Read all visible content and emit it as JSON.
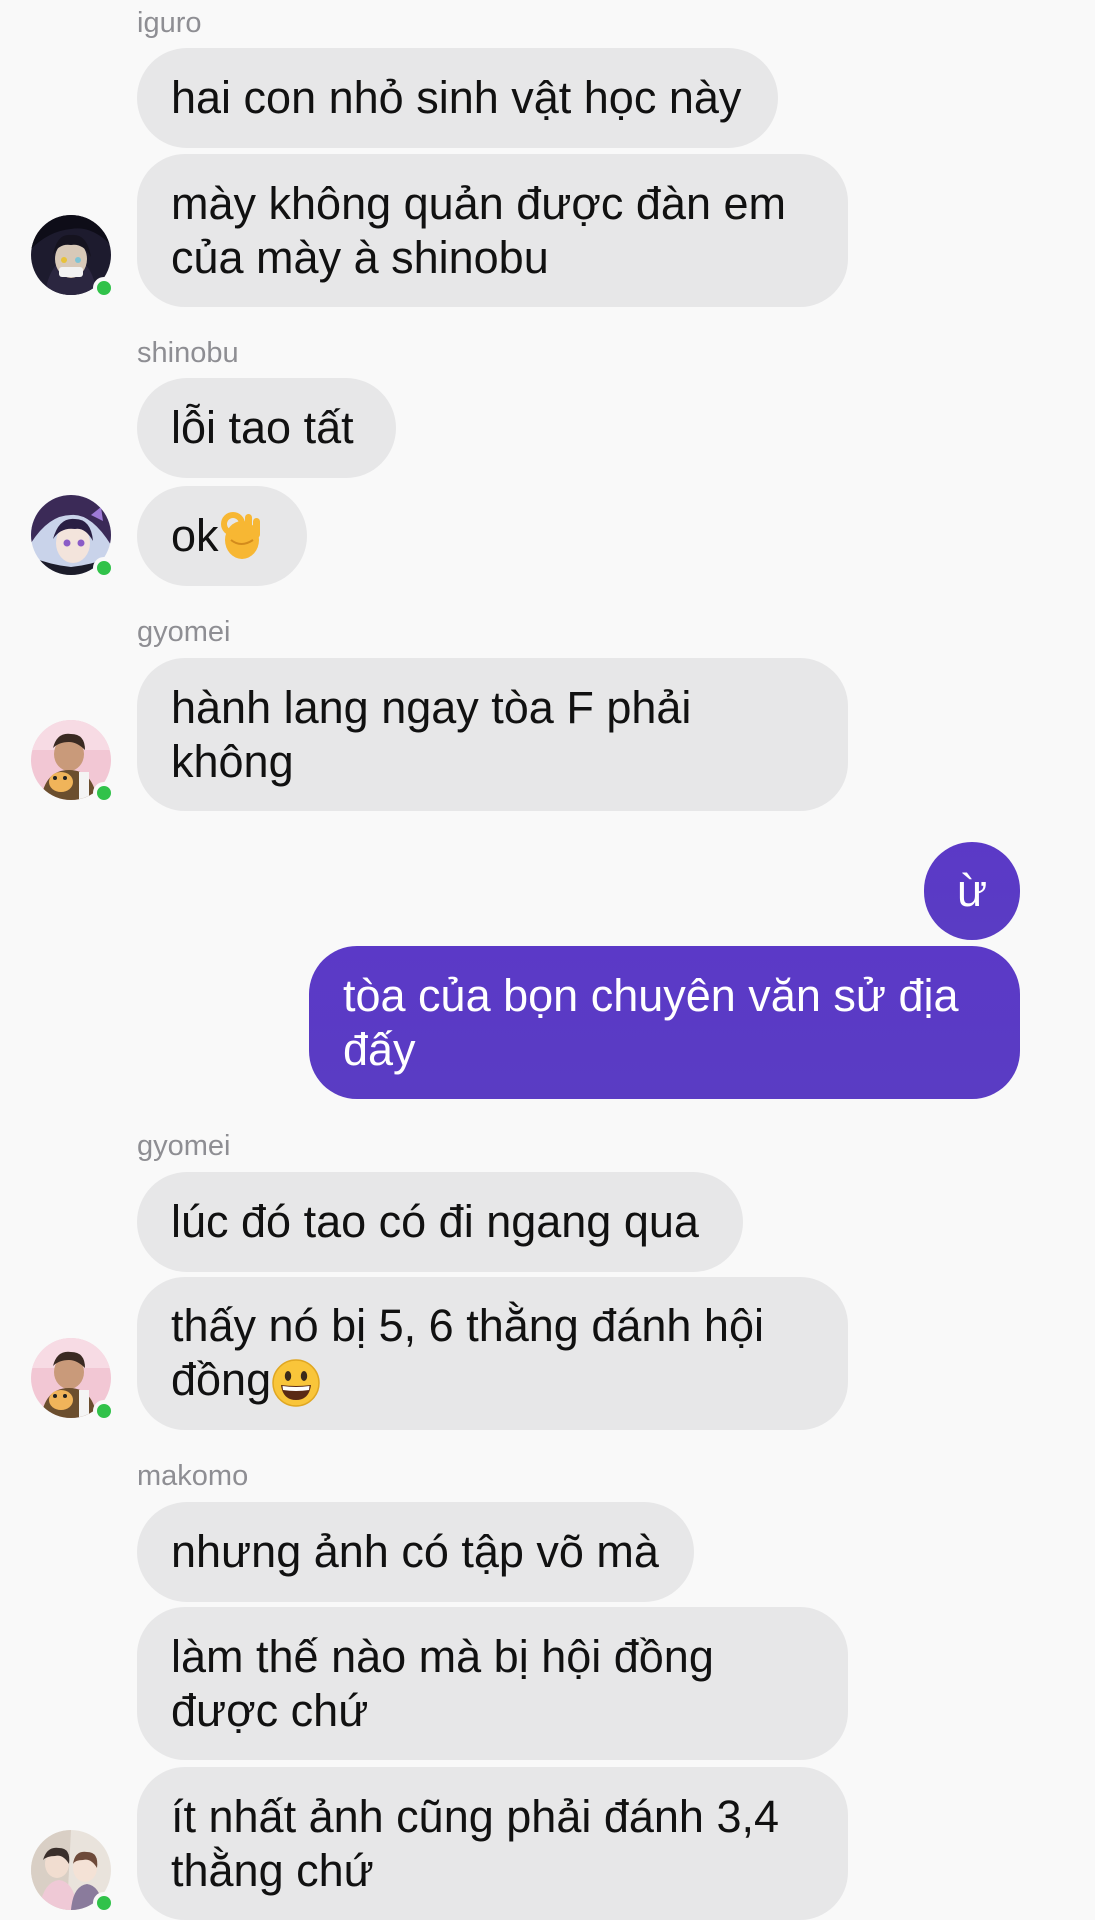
{
  "thread": {
    "groups": [
      {
        "sender": "iguro",
        "messages": [
          "hai con nhỏ sinh vật học này",
          "mày không quản được đàn em của mày à shinobu"
        ],
        "avatar": "iguro-avatar"
      },
      {
        "sender": "shinobu",
        "messages": [
          "lỗi tao tất",
          "ok"
        ],
        "avatar": "shinobu-avatar",
        "emoji": "ok-hand-emoji"
      },
      {
        "sender": "gyomei",
        "messages": [
          "hành lang ngay tòa F phải không"
        ],
        "avatar": "gyomei-avatar"
      },
      {
        "sender": "me",
        "messages": [
          "ừ",
          "tòa của bọn chuyên văn sử địa đấy"
        ]
      },
      {
        "sender": "gyomei",
        "messages": [
          "lúc đó tao có đi ngang qua",
          "thấy nó bị 5, 6 thằng đánh hội đồng"
        ],
        "avatar": "gyomei-avatar",
        "emoji": "grinning-face-emoji"
      },
      {
        "sender": "makomo",
        "messages": [
          "nhưng ảnh có tập võ mà",
          "làm thế nào mà bị hội đồng được chứ",
          "ít nhất ảnh cũng phải đánh 3,4 thằng chứ"
        ],
        "avatar": "makomo-avatar"
      }
    ]
  },
  "colors": {
    "background": "#f9f9f9",
    "incoming_bubble": "#e7e7e8",
    "outgoing_bubble": "#5a3cc6",
    "sender_name": "#8e8e93",
    "online_dot": "#31c24a"
  }
}
